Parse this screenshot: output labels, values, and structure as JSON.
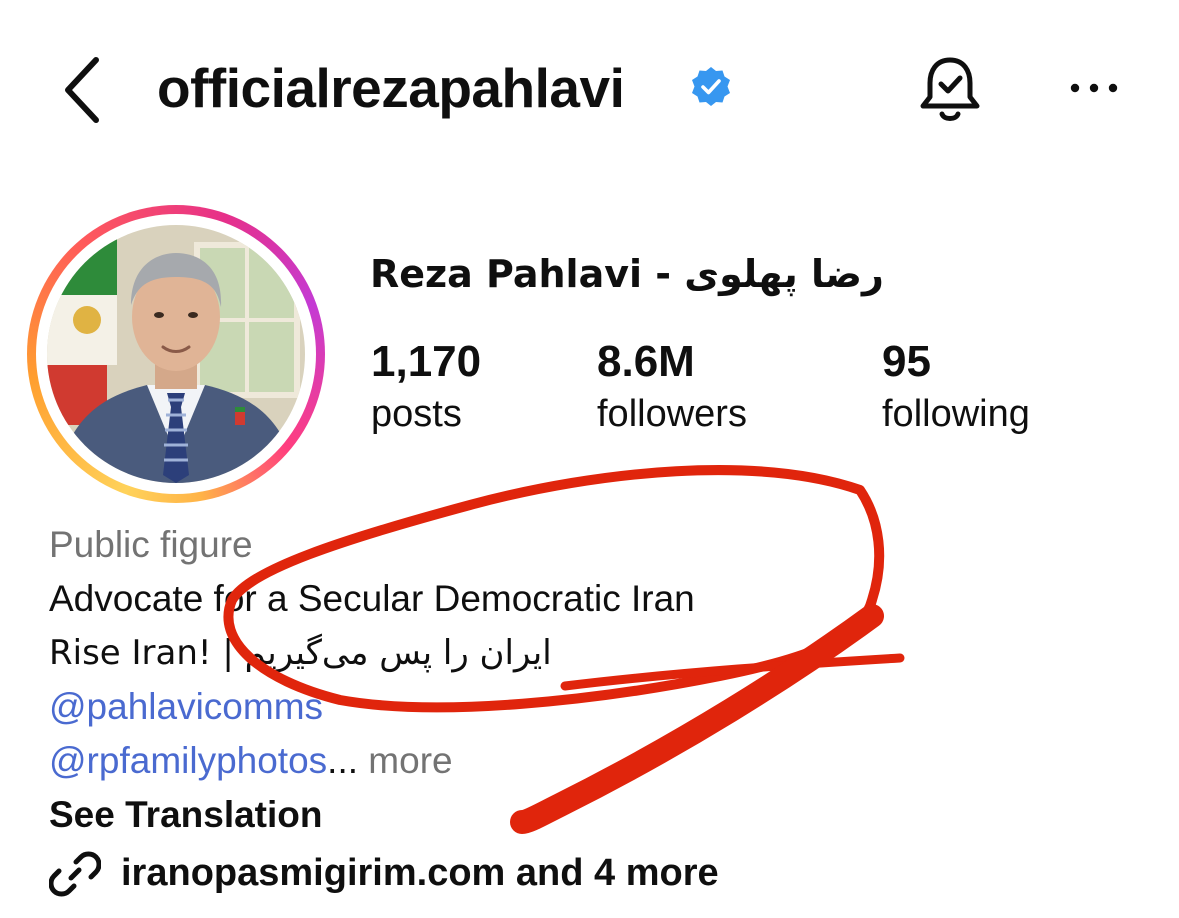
{
  "header": {
    "username": "officialrezapahlavi",
    "verified_icon": "verified-badge-icon",
    "back_icon": "chevron-left-icon",
    "bell_icon": "notification-bell-check-icon",
    "more_icon": "more-horizontal-icon"
  },
  "profile": {
    "display_name": "Reza Pahlavi - رضا پهلوی",
    "stats": [
      {
        "value": "1,170",
        "label": "posts"
      },
      {
        "value": "8.6M",
        "label": "followers"
      },
      {
        "value": "95",
        "label": "following"
      }
    ]
  },
  "bio": {
    "category": "Public figure",
    "line1": "Advocate for a Secular Democratic Iran",
    "line2": "Rise Iran! | ایران را پس می‌گیریم",
    "mention1": "@pahlavicomms",
    "mention2": "@rpfamilyphotos",
    "ellipsis": "...",
    "more": " more",
    "see_translation": "See Translation",
    "link_icon": "link-icon",
    "link_text": "iranopasmigirim.com and 4 more"
  },
  "colors": {
    "verified_blue": "#3797f0",
    "link_blue": "#4a6ad0",
    "muted_gray": "#737373",
    "annotation_red": "#e0250c"
  }
}
